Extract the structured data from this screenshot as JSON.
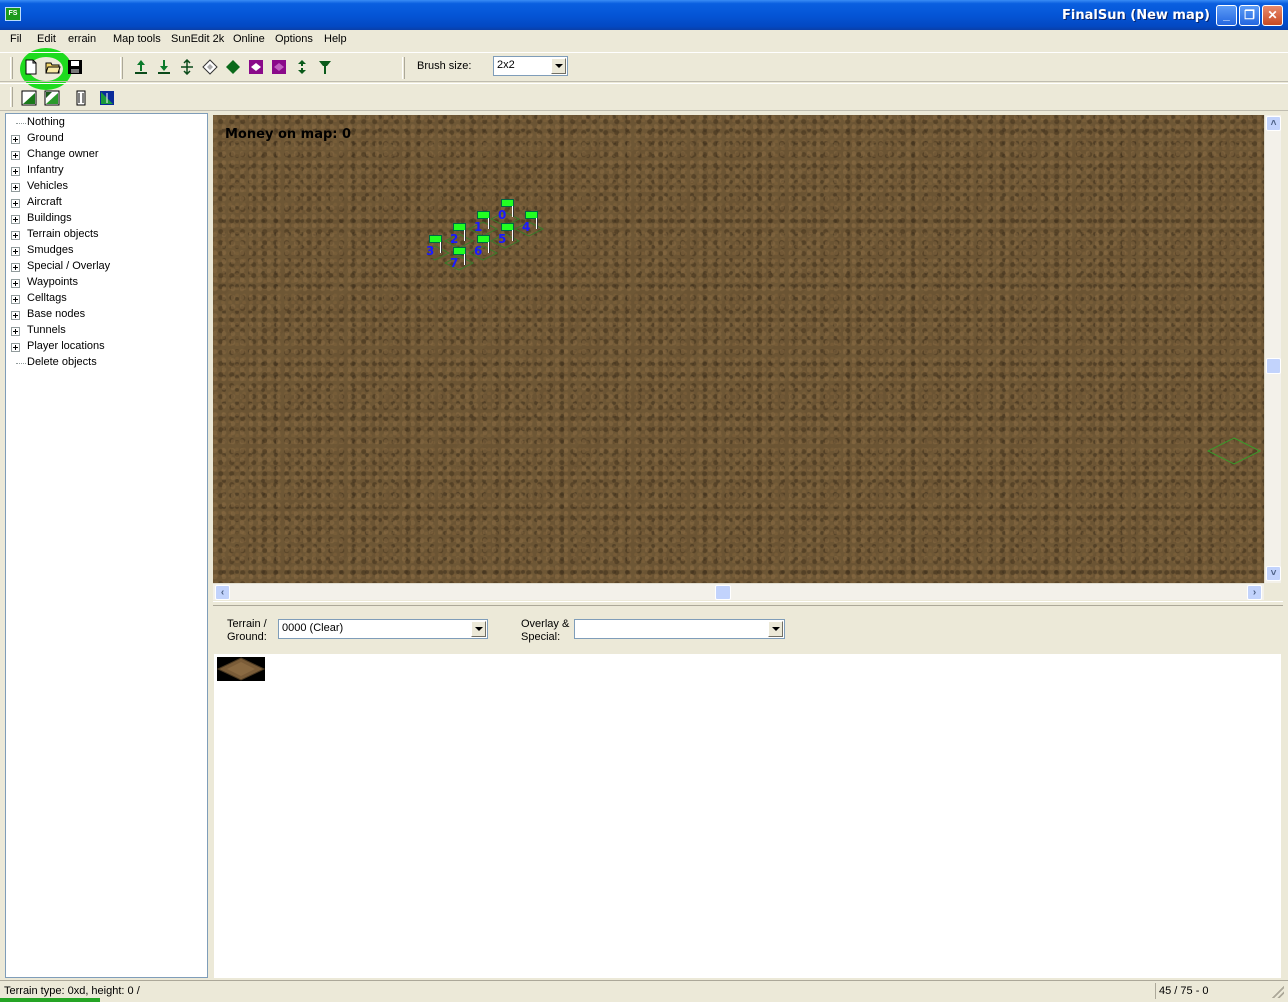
{
  "window": {
    "title": "FinalSun (New map)",
    "icon_text": "FS"
  },
  "menu": [
    "File",
    "Edit",
    "Terrain",
    "Map tools",
    "SunEdit 2k",
    "Online",
    "Options",
    "Help"
  ],
  "menu_display": [
    "Fil",
    "Edit",
    "errain",
    "Map tools",
    "SunEdit 2k",
    "Online",
    "Options",
    "Help"
  ],
  "toolbar": {
    "brush_label": "Brush size:",
    "brush_value": "2x2"
  },
  "tree": {
    "items": [
      {
        "label": "Nothing",
        "expandable": false
      },
      {
        "label": "Ground",
        "expandable": true
      },
      {
        "label": "Change owner",
        "expandable": true
      },
      {
        "label": "Infantry",
        "expandable": true
      },
      {
        "label": "Vehicles",
        "expandable": true
      },
      {
        "label": "Aircraft",
        "expandable": true
      },
      {
        "label": "Buildings",
        "expandable": true
      },
      {
        "label": "Terrain objects",
        "expandable": true
      },
      {
        "label": "Smudges",
        "expandable": true
      },
      {
        "label": "Special / Overlay",
        "expandable": true
      },
      {
        "label": "Waypoints",
        "expandable": true
      },
      {
        "label": "Celltags",
        "expandable": true
      },
      {
        "label": "Base nodes",
        "expandable": true
      },
      {
        "label": "Tunnels",
        "expandable": true
      },
      {
        "label": "Player locations",
        "expandable": true
      },
      {
        "label": "Delete objects",
        "expandable": false
      }
    ]
  },
  "map": {
    "money_text": "Money on map: 0",
    "waypoints": [
      "0",
      "1",
      "2",
      "3",
      "4",
      "5",
      "6",
      "7"
    ]
  },
  "terrain_bar": {
    "terrain_label_1": "Terrain /",
    "terrain_label_2": "Ground:",
    "terrain_value": "0000 (Clear)",
    "overlay_label_1": "Overlay &",
    "overlay_label_2": "Special:",
    "overlay_value": ""
  },
  "status": {
    "left": "Terrain type: 0xd, height: 0 /",
    "right": "45 / 75 - 0"
  },
  "colors": {
    "title_blue": "#0455d6",
    "highlight_green": "#1edb1e",
    "waypoint_flag": "#22ff22",
    "waypoint_number": "#1a1aff",
    "terrain": "#6b5433"
  }
}
